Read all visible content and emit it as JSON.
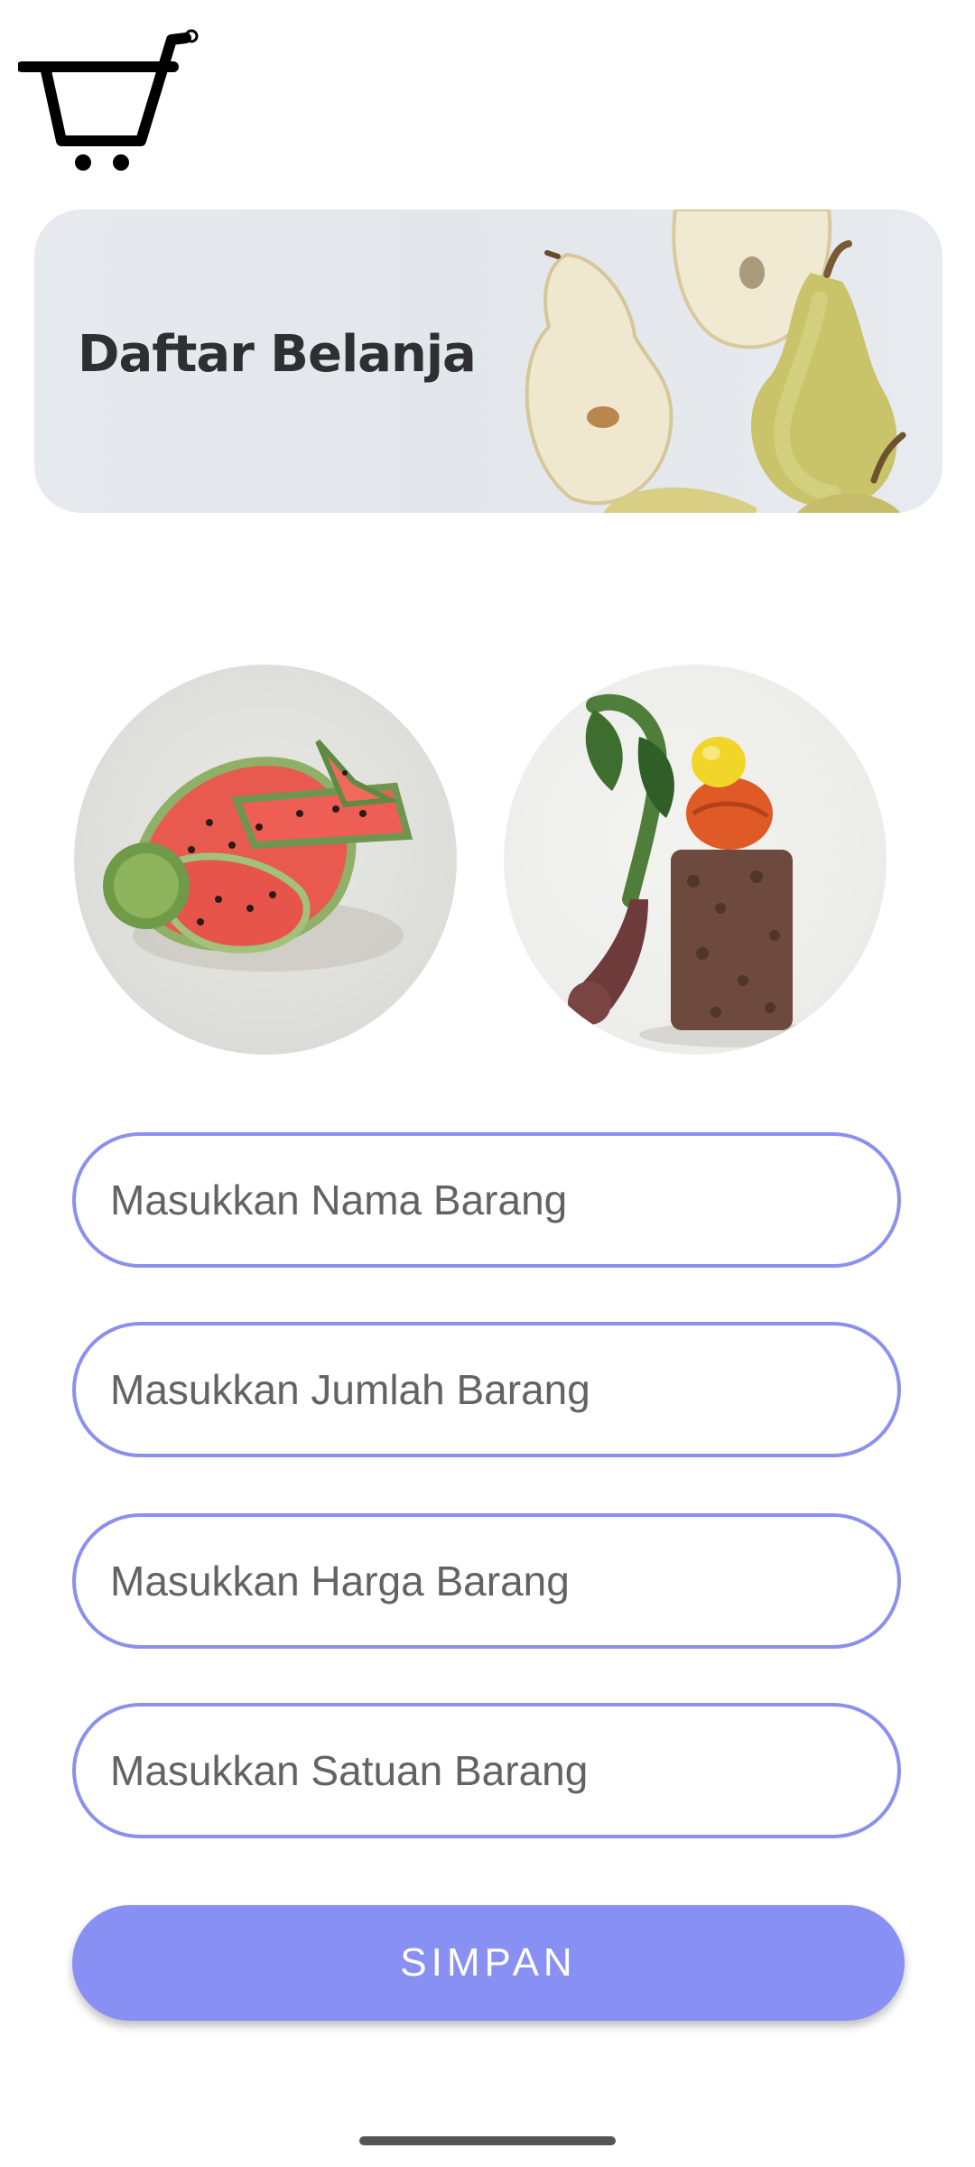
{
  "header": {
    "icon": "shopping-cart-icon"
  },
  "banner": {
    "title": "Daftar Belanja",
    "image": "pears-image"
  },
  "photos": [
    {
      "image": "watermelon-image"
    },
    {
      "image": "vegetables-image"
    }
  ],
  "form": {
    "fields": [
      {
        "placeholder": "Masukkan Nama Barang",
        "value": ""
      },
      {
        "placeholder": "Masukkan Jumlah Barang",
        "value": ""
      },
      {
        "placeholder": "Masukkan Harga Barang",
        "value": ""
      },
      {
        "placeholder": "Masukkan Satuan Barang",
        "value": ""
      }
    ],
    "save_label": "SIMPAN"
  },
  "colors": {
    "accent": "#8890f4",
    "field_border": "#8a90ee",
    "banner_bg": "#e5e8ec"
  }
}
